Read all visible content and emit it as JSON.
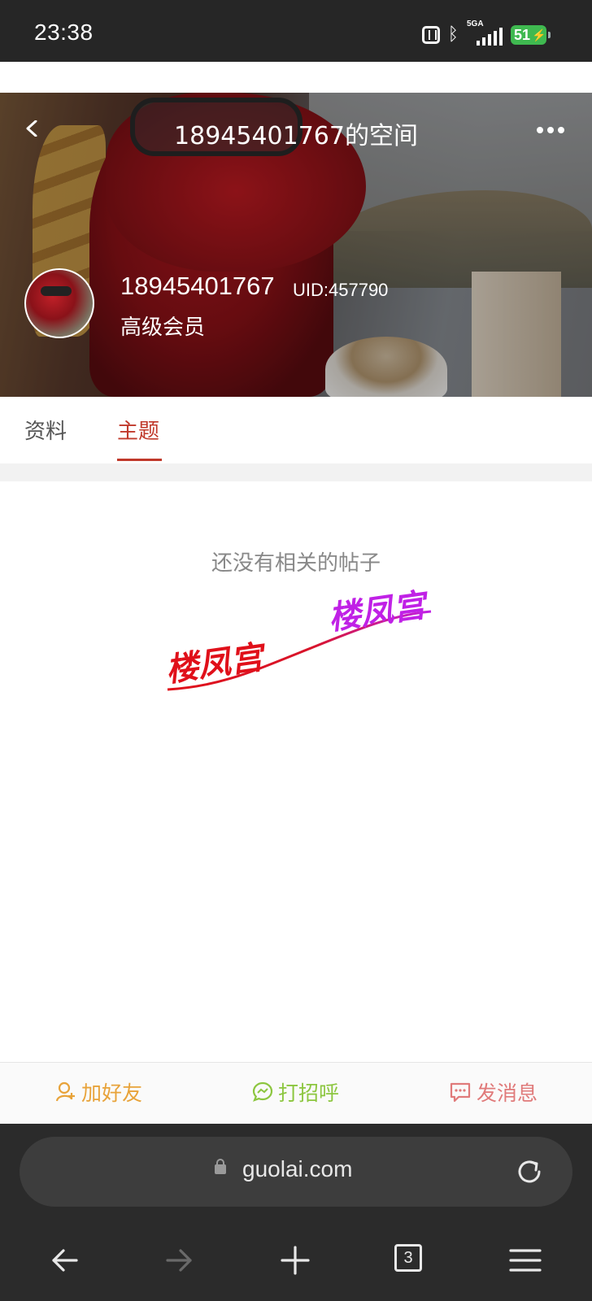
{
  "status_bar": {
    "time": "23:38",
    "network_type": "5GA",
    "battery_level": "51",
    "icons": [
      "nfc-icon",
      "bluetooth-icon",
      "signal-icon",
      "battery-charging-icon"
    ]
  },
  "header": {
    "title": "18945401767的空间",
    "back_icon": "chevron-left-icon",
    "more_icon": "more-horizontal-icon"
  },
  "profile": {
    "username": "18945401767",
    "uid": "UID:457790",
    "level": "高级会员"
  },
  "tabs": [
    {
      "label": "资料",
      "active": false
    },
    {
      "label": "主题",
      "active": true
    }
  ],
  "content": {
    "empty_message": "还没有相关的帖子",
    "watermark_text": "楼凤宫"
  },
  "actions": {
    "add_friend": "加好友",
    "say_hello": "打招呼",
    "send_message": "发消息"
  },
  "browser": {
    "url": "guolai.com",
    "tab_count": "3"
  },
  "colors": {
    "accent": "#c0392b",
    "add_friend": "#e8a33a",
    "say_hello": "#8cc63f",
    "send_message": "#e07a7a"
  }
}
